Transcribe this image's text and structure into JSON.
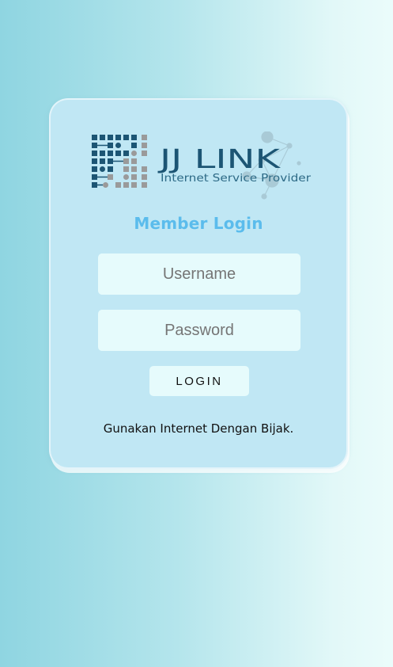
{
  "logo": {
    "brand": "JJ LINK",
    "tagline": "Internet Service Provider"
  },
  "login": {
    "heading": "Member Login",
    "username_placeholder": "Username",
    "password_placeholder": "Password",
    "submit_label": "LOGIN"
  },
  "footer": {
    "message": "Gunakan Internet Dengan Bijak."
  },
  "colors": {
    "accent": "#5bbcec",
    "brand_dark": "#1c5574",
    "card": "#c0e7f4",
    "field": "#e6fbfc"
  }
}
